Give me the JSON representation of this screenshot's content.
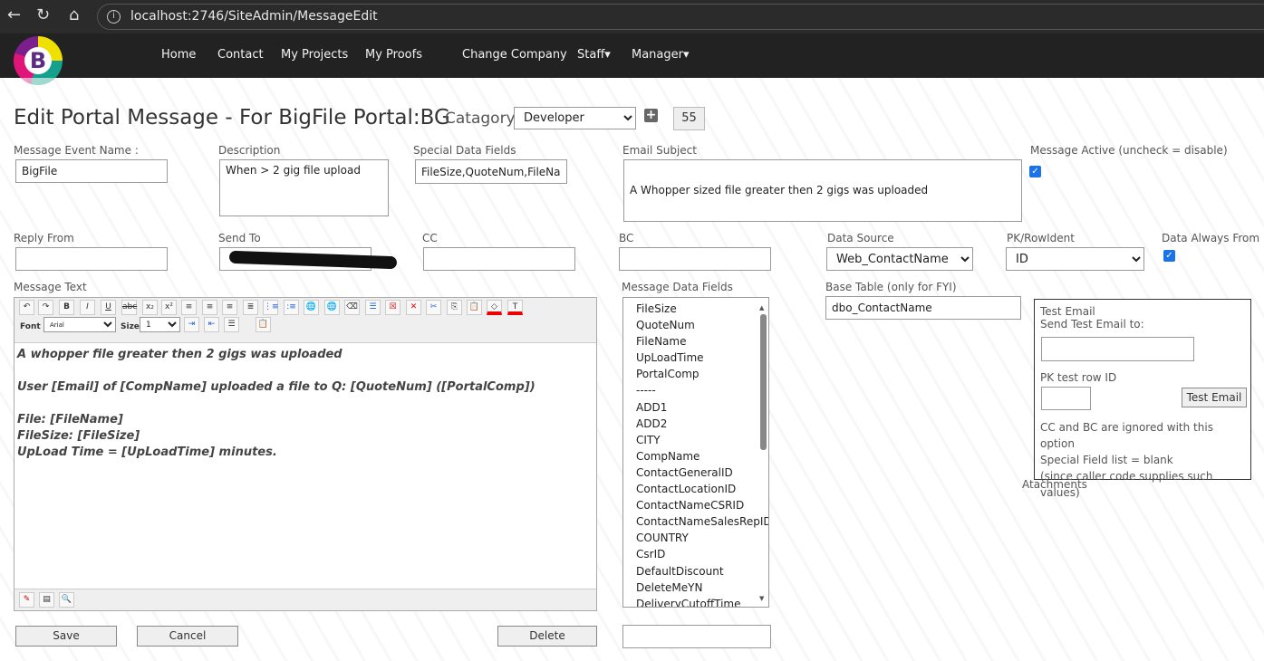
{
  "browser": {
    "url": "localhost:2746/SiteAdmin/MessageEdit"
  },
  "nav": {
    "logo_letter": "B",
    "items": [
      "Home",
      "Contact",
      "My Projects",
      "My Proofs",
      "Change Company",
      "Staff▾",
      "Manager▾"
    ]
  },
  "page": {
    "title": "Edit Portal Message - For BigFile Portal:BG",
    "category_label": "Catagory",
    "category_value": "Developer",
    "id_value": "55"
  },
  "fields": {
    "event_name": {
      "label": "Message Event Name :",
      "value": "BigFile"
    },
    "description": {
      "label": "Description",
      "value": "When > 2 gig file upload"
    },
    "special": {
      "label": "Special Data Fields",
      "value": "FileSize,QuoteNum,FileName"
    },
    "subject": {
      "label": "Email Subject",
      "value": "A Whopper sized file greater then 2 gigs was uploaded"
    },
    "active": {
      "label": "Message Active (uncheck = disable)"
    },
    "reply_from": {
      "label": "Reply From",
      "value": ""
    },
    "send_to": {
      "label": "Send To"
    },
    "cc": {
      "label": "CC",
      "value": ""
    },
    "bc": {
      "label": "BC",
      "value": ""
    },
    "data_source": {
      "label": "Data Source",
      "value": "Web_ContactName"
    },
    "pk": {
      "label": "PK/RowIdent",
      "value": "ID"
    },
    "always": {
      "label": "Data Always From Bu"
    },
    "message_text": {
      "label": "Message Text"
    },
    "data_fields": {
      "label": "Message Data Fields"
    },
    "base_table": {
      "label": "Base Table (only for FYI)",
      "value": "dbo_ContactName"
    }
  },
  "editor": {
    "font_label": "Font",
    "font_value": "Arial",
    "size_label": "Size",
    "size_value": "1",
    "lines": [
      "A whopper file greater then 2 gigs was uploaded",
      "User [Email] of [CompName] uploaded a file to Q: [QuoteNum] ([PortalComp])",
      "File: [FileName]",
      "FileSize: [FileSize]",
      "UpLoad Time = [UpLoadTime] minutes."
    ]
  },
  "data_fields": [
    "FileSize",
    "QuoteNum",
    "FileName",
    "UpLoadTime",
    "PortalComp",
    "-----",
    "ADD1",
    "ADD2",
    "CITY",
    "CompName",
    "ContactGeneralID",
    "ContactLocationID",
    "ContactNameCSRID",
    "ContactNameSalesRepID",
    "COUNTRY",
    "CsrID",
    "DefaultDiscount",
    "DeleteMeYN",
    "DeliveryCutoffTime"
  ],
  "test": {
    "title": "Test Email",
    "send_label": "Send Test Email to:",
    "pk_label": "PK test row ID",
    "button": "Test Email",
    "note1": "CC and BC are ignored with this option",
    "note2": "Special Field list = blank",
    "note3": "(since caller code supplies such values)"
  },
  "attachments": "Atachments",
  "buttons": {
    "save": "Save",
    "cancel": "Cancel",
    "delete": "Delete"
  }
}
